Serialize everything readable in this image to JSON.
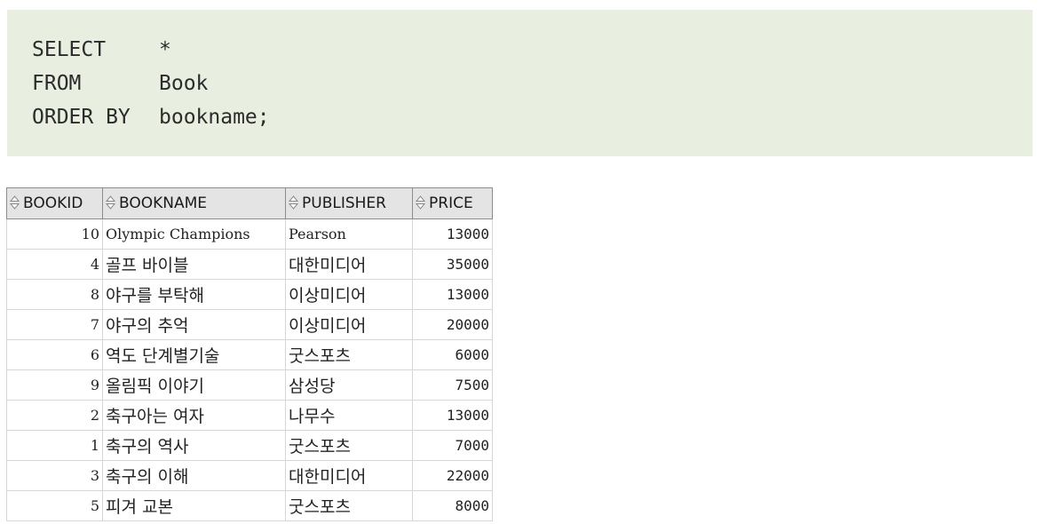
{
  "query": {
    "lines": [
      {
        "keyword": "SELECT",
        "argument": "*"
      },
      {
        "keyword": "FROM",
        "argument": "Book"
      },
      {
        "keyword": "ORDER BY",
        "argument": "bookname;"
      }
    ]
  },
  "result_grid": {
    "columns": [
      "BOOKID",
      "BOOKNAME",
      "PUBLISHER",
      "PRICE"
    ],
    "rows": [
      [
        "10",
        "Olympic Champions",
        "Pearson",
        "13000"
      ],
      [
        "4",
        "골프 바이블",
        "대한미디어",
        "35000"
      ],
      [
        "8",
        "야구를 부탁해",
        "이상미디어",
        "13000"
      ],
      [
        "7",
        "야구의 추억",
        "이상미디어",
        "20000"
      ],
      [
        "6",
        "역도 단계별기술",
        "굿스포츠",
        "6000"
      ],
      [
        "9",
        "올림픽 이야기",
        "삼성당",
        "7500"
      ],
      [
        "2",
        "축구아는 여자",
        "나무수",
        "13000"
      ],
      [
        "1",
        "축구의 역사",
        "굿스포츠",
        "7000"
      ],
      [
        "3",
        "축구의 이해",
        "대한미디어",
        "22000"
      ],
      [
        "5",
        "피겨 교본",
        "굿스포츠",
        "8000"
      ]
    ],
    "sort_icon": "sort-up-down-icon"
  }
}
